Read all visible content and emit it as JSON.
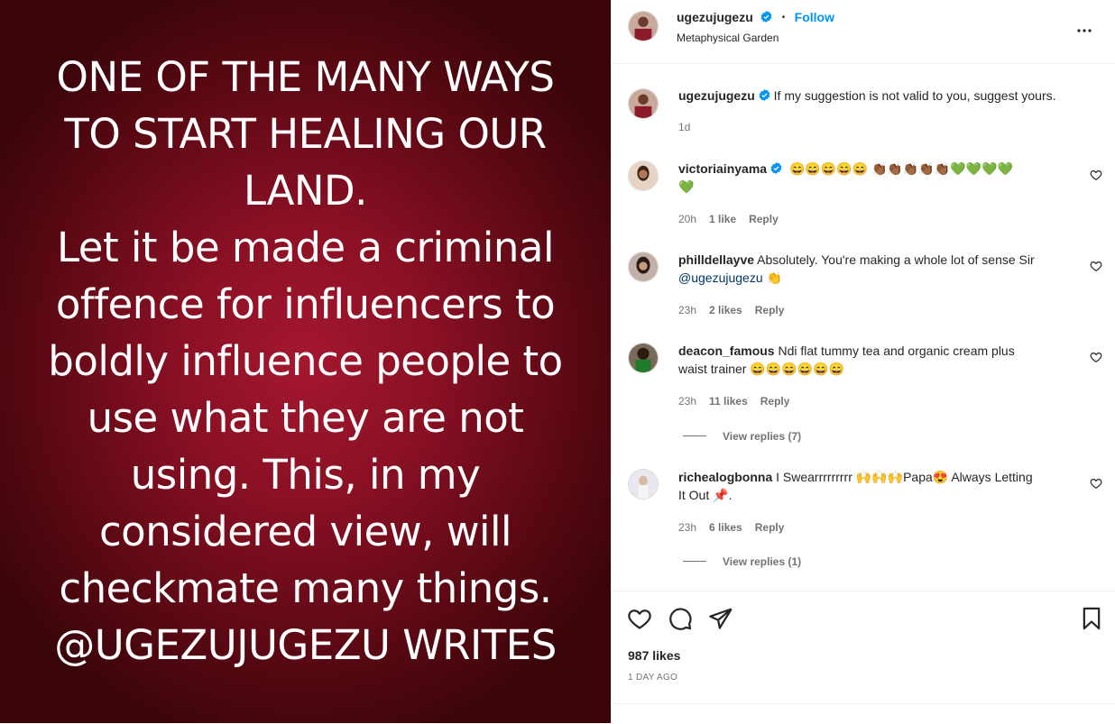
{
  "post": {
    "image_lines": [
      "ONE OF THE MANY WAYS",
      "TO START HEALING OUR",
      "LAND.",
      "Let it be made a criminal",
      "offence for influencers to",
      "boldly influence people to",
      "use what they are not",
      "using. This, in my",
      "considered view, will",
      "checkmate many things.",
      "@UGEZUJUGEZU WRITES"
    ],
    "image_bg": "#8a1024"
  },
  "header": {
    "username": "ugezujugezu",
    "dot": "•",
    "follow_label": "Follow",
    "location": "Metaphysical Garden",
    "more_icon": "more-horizontal-icon"
  },
  "caption": {
    "username": "ugezujugezu",
    "text": "If my suggestion is not valid to you, suggest yours.",
    "time": "1d"
  },
  "comments": [
    {
      "username": "victoriainyama",
      "verified": true,
      "text": "😄😄😄😄😄 👏🏾👏🏾👏🏾👏🏾👏🏾💚💚💚💚",
      "text2": "💚",
      "time": "20h",
      "likes": "1 like",
      "reply": "Reply"
    },
    {
      "username": "philldellayve",
      "text": "Absolutely. You're making a whole lot of sense Sir",
      "mention": "@ugezujugezu",
      "emoji": "👏",
      "time": "23h",
      "likes": "2 likes",
      "reply": "Reply"
    },
    {
      "username": "deacon_famous",
      "text": "Ndi flat tummy tea and organic cream plus",
      "text2": "waist trainer",
      "emoji": "😄😄😄😄😄😄",
      "time": "23h",
      "likes": "11 likes",
      "reply": "Reply",
      "view_replies": "View replies (7)"
    },
    {
      "username": "richealogbonna",
      "text": "I Swearrrrrrrrr",
      "emoji1": "🙌🙌🙌",
      "text_b": "Papa",
      "emoji2": "😍",
      "text_c": " Always Letting",
      "text2": "It Out",
      "emoji3": "📌",
      "text3": ".",
      "time": "23h",
      "likes": "6 likes",
      "reply": "Reply",
      "view_replies": "View replies (1)"
    }
  ],
  "actions": {
    "like_icon": "heart-icon",
    "comment_icon": "comment-icon",
    "share_icon": "share-icon",
    "save_icon": "bookmark-icon",
    "likes": "987 likes",
    "date": "1 DAY AGO"
  },
  "colors": {
    "accent": "#0095f6",
    "verified": "#0095f6",
    "muted": "#737373",
    "text": "#262626"
  }
}
